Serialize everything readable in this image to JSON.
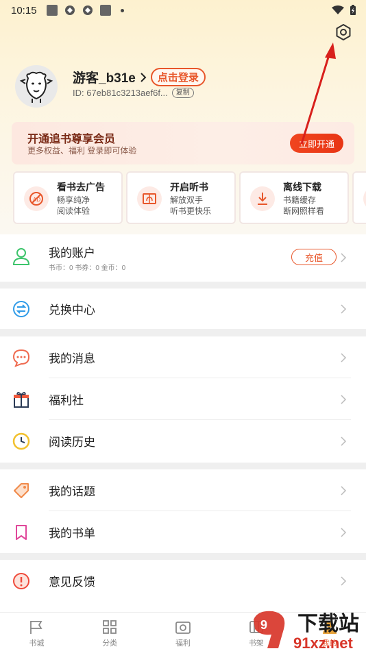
{
  "status_bar": {
    "time": "10:15"
  },
  "profile": {
    "username": "游客_b31e",
    "login_label": "点击登录",
    "id_text": "ID: 67eb81c3213aef6f...",
    "copy_label": "复制"
  },
  "vip": {
    "title": "开通追书尊享会员",
    "subtitle": "更多权益、福利 登录即可体验",
    "button": "立即开通"
  },
  "features": [
    {
      "title": "看书去广告",
      "line1": "畅享纯净",
      "line2": "阅读体验",
      "icon": "no-ads-icon"
    },
    {
      "title": "开启听书",
      "line1": "解放双手",
      "line2": "听书更快乐",
      "icon": "headphone-book-icon"
    },
    {
      "title": "离线下载",
      "line1": "书籍缓存",
      "line2": "断网照样看",
      "icon": "download-icon"
    }
  ],
  "account": {
    "label": "我的账户",
    "sub": "书币：0    书券：0    金币：0",
    "recharge": "充值"
  },
  "menu": {
    "exchange": "兑换中心",
    "messages": "我的消息",
    "welfare": "福利社",
    "history": "阅读历史",
    "topics": "我的话题",
    "booklist": "我的书单",
    "feedback": "意见反馈"
  },
  "bottom_nav": [
    {
      "label": "书城",
      "icon": "flag-icon"
    },
    {
      "label": "分类",
      "icon": "grid-icon"
    },
    {
      "label": "福利",
      "icon": "welfare-icon"
    },
    {
      "label": "书架",
      "icon": "shelf-icon"
    },
    {
      "label": "我的",
      "icon": "user-icon"
    }
  ],
  "watermark": {
    "text": "下载站",
    "url": "91xz.net"
  },
  "colors": {
    "accent": "#e8562a",
    "annotation_arrow": "#d8201c"
  }
}
